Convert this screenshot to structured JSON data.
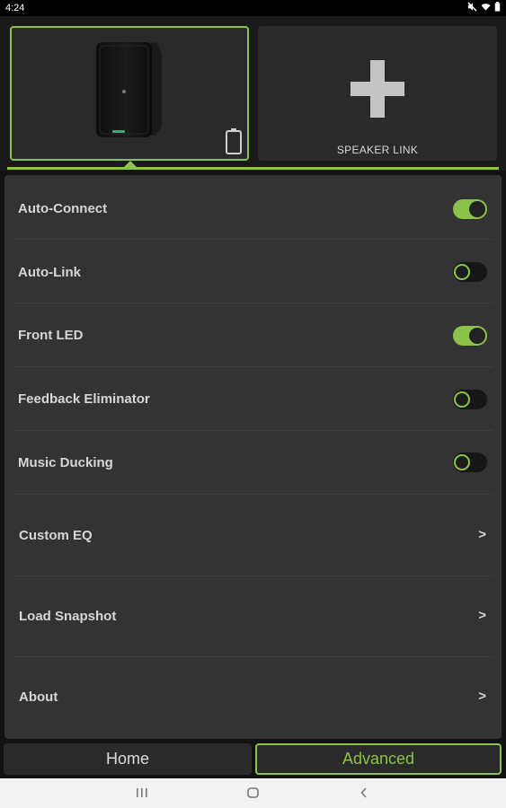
{
  "status_bar": {
    "time": "4:24",
    "icons": [
      "mute-icon",
      "wifi-icon",
      "battery-icon"
    ]
  },
  "devices": {
    "speaker_tile": {
      "device": "speaker",
      "battery_icon": "battery-outline-icon"
    },
    "add_tile": {
      "label": "SPEAKER LINK",
      "icon": "plus-icon"
    }
  },
  "settings": {
    "auto_connect": {
      "label": "Auto-Connect",
      "state": "on"
    },
    "auto_link": {
      "label": "Auto-Link",
      "state": "off"
    },
    "front_led": {
      "label": "Front LED",
      "state": "on"
    },
    "feedback_eliminator": {
      "label": "Feedback Eliminator",
      "state": "off"
    },
    "music_ducking": {
      "label": "Music Ducking",
      "state": "off"
    },
    "custom_eq": {
      "label": "Custom EQ",
      "chevron": ">"
    },
    "load_snapshot": {
      "label": "Load Snapshot",
      "chevron": ">"
    },
    "about": {
      "label": "About",
      "chevron": ">"
    }
  },
  "tabs": {
    "home": "Home",
    "advanced": "Advanced",
    "active": "advanced"
  },
  "colors": {
    "accent": "#8bc34a",
    "panel": "#333333",
    "background": "#121212"
  },
  "nav_bar": {
    "buttons": [
      "recent-apps-icon",
      "home-circle-icon",
      "back-icon"
    ]
  }
}
